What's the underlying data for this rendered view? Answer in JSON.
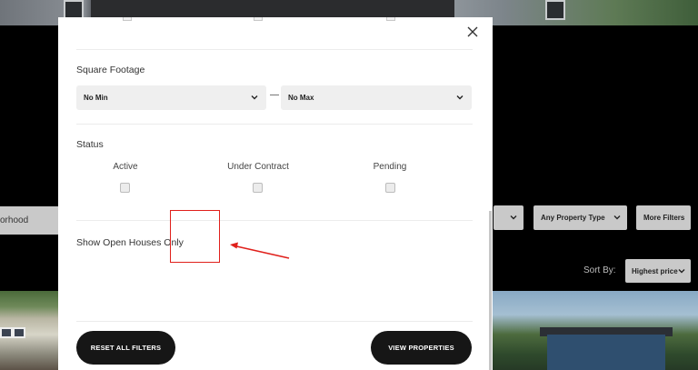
{
  "background": {
    "search_text": "orhood",
    "filters": {
      "property_type_label": "Any Property Type",
      "more_filters_label": "More Filters"
    },
    "sort": {
      "label": "Sort By:",
      "value": "Highest price"
    }
  },
  "modal": {
    "square_footage": {
      "label": "Square Footage",
      "min_value": "No Min",
      "separator": "—",
      "max_value": "No Max"
    },
    "status": {
      "label": "Status",
      "options": [
        {
          "label": "Active",
          "checked": false
        },
        {
          "label": "Under Contract",
          "checked": false
        },
        {
          "label": "Pending",
          "checked": false
        }
      ]
    },
    "open_houses": {
      "label": "Show Open Houses Only"
    },
    "reset_label": "RESET ALL FILTERS",
    "view_label": "VIEW PROPERTIES"
  },
  "annotation": {
    "color": "#e0201b"
  }
}
